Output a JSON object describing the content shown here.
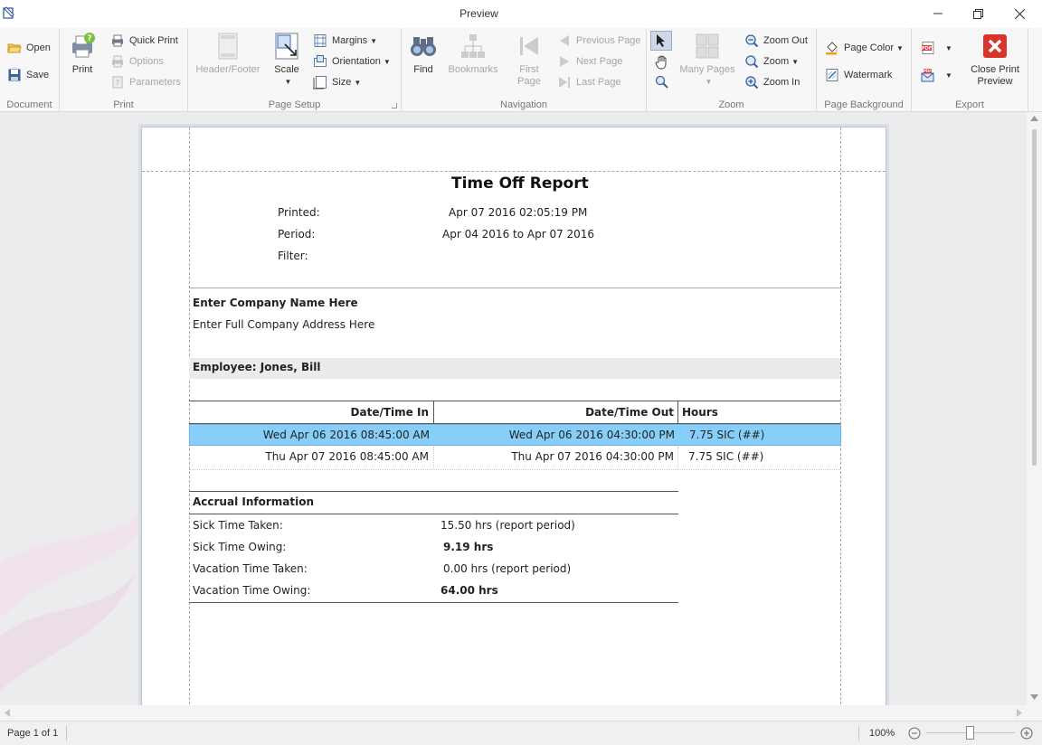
{
  "window": {
    "title": "Preview"
  },
  "ribbon": {
    "groups": {
      "document": "Document",
      "print": "Print",
      "page_setup": "Page Setup",
      "navigation": "Navigation",
      "zoom": "Zoom",
      "page_background": "Page Background",
      "export": "Export"
    },
    "buttons": {
      "open": "Open",
      "save": "Save",
      "print": "Print",
      "quick_print": "Quick Print",
      "options": "Options",
      "parameters": "Parameters",
      "header_footer": "Header/Footer",
      "scale": "Scale",
      "margins": "Margins",
      "orientation": "Orientation",
      "size": "Size",
      "find": "Find",
      "bookmarks": "Bookmarks",
      "first_page_1": "First",
      "first_page_2": "Page",
      "previous_page": "Previous Page",
      "next_page": "Next Page",
      "last_page": "Last Page",
      "many_pages": "Many Pages",
      "zoom_out": "Zoom Out",
      "zoom": "Zoom",
      "zoom_in": "Zoom In",
      "page_color": "Page Color",
      "watermark": "Watermark",
      "close_1": "Close Print",
      "close_2": "Preview"
    }
  },
  "report": {
    "title": "Time Off Report",
    "printed_label": "Printed:",
    "printed_value": "Apr 07 2016 02:05:19 PM",
    "period_label": "Period:",
    "period_value": "Apr 04 2016 to Apr 07 2016",
    "filter_label": "Filter:",
    "company_name": "Enter Company Name Here",
    "company_address": "Enter Full Company Address Here",
    "employee": "Employee: Jones, Bill",
    "columns": [
      "Date/Time In",
      "Date/Time Out",
      "Hours"
    ],
    "rows": [
      {
        "in": "Wed Apr 06 2016 08:45:00 AM",
        "out": "Wed Apr 06 2016 04:30:00 PM",
        "hours": "7.75 SIC (##)"
      },
      {
        "in": "Thu Apr 07 2016 08:45:00 AM",
        "out": "Thu Apr 07 2016 04:30:00 PM",
        "hours": "7.75 SIC (##)"
      }
    ],
    "accrual_title": "Accrual Information",
    "accrual": [
      {
        "label": "Sick Time Taken:",
        "value": "15.50 hrs (report period)"
      },
      {
        "label": "Sick Time Owing:",
        "value": "9.19 hrs"
      },
      {
        "label": "Vacation Time Taken:",
        "value": "0.00 hrs (report period)"
      },
      {
        "label": "Vacation Time Owing:",
        "value": "64.00 hrs"
      }
    ]
  },
  "status": {
    "page": "Page 1 of 1",
    "zoom": "100%"
  },
  "colors": {
    "selection": "#87cefa",
    "accent": "#2b579a"
  }
}
